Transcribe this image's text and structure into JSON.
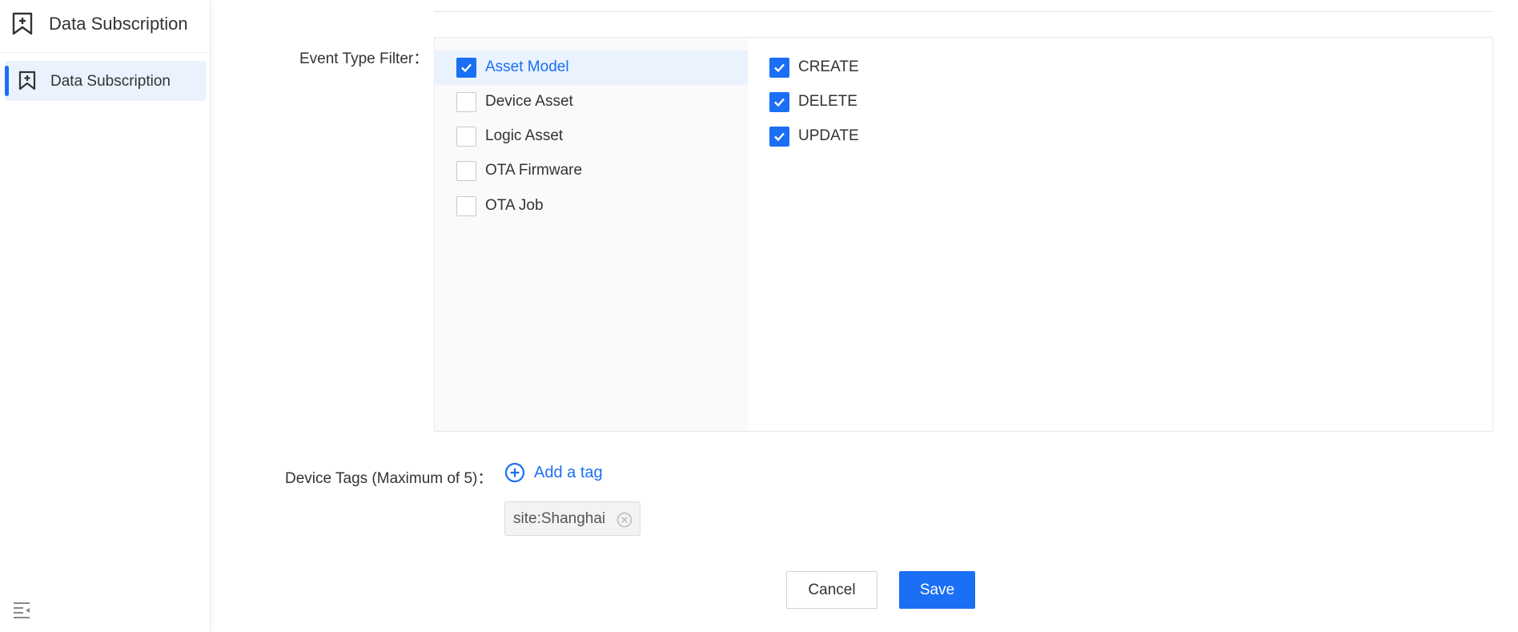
{
  "sidebar": {
    "header_title": "Data Subscription",
    "active_item_label": "Data Subscription"
  },
  "form": {
    "event_type_filter_label": "Event Type Filter：",
    "device_tags_label": "Device Tags (Maximum of 5)：",
    "add_tag_label": "Add a tag",
    "tags": [
      "site:Shanghai"
    ],
    "event_types": [
      {
        "label": "Asset Model",
        "checked": true,
        "active": true
      },
      {
        "label": "Device Asset",
        "checked": false,
        "active": false
      },
      {
        "label": "Logic Asset",
        "checked": false,
        "active": false
      },
      {
        "label": "OTA Firmware",
        "checked": false,
        "active": false
      },
      {
        "label": "OTA Job",
        "checked": false,
        "active": false
      }
    ],
    "operations": [
      {
        "label": "CREATE",
        "checked": true
      },
      {
        "label": "DELETE",
        "checked": true
      },
      {
        "label": "UPDATE",
        "checked": true
      }
    ]
  },
  "buttons": {
    "cancel_label": "Cancel",
    "save_label": "Save"
  },
  "colors": {
    "accent": "#1a6ff5",
    "active_bg": "#eaf2fd"
  },
  "icons": {
    "sidebar_header": "bookmark-add-icon",
    "sidebar_item": "bookmark-add-icon",
    "collapse": "collapse-menu-icon",
    "add_tag": "plus-circle-icon",
    "tag_remove": "close-circle-icon",
    "checkbox": "check-icon"
  }
}
